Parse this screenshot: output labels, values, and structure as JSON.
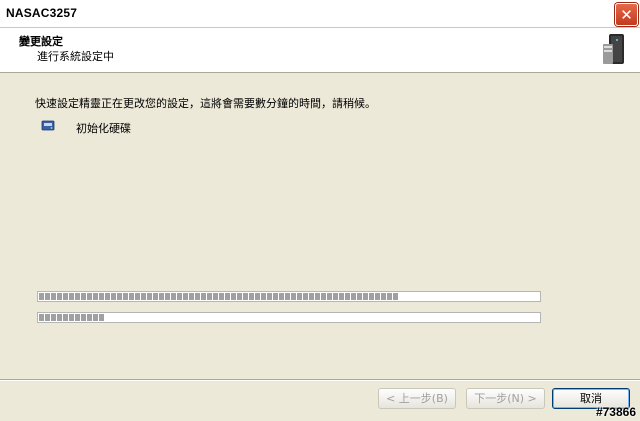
{
  "window": {
    "title": "NASAC3257",
    "close_symbol": "✕"
  },
  "header": {
    "title": "變更設定",
    "subtitle": "進行系統設定中",
    "icon": "nas-device-icon"
  },
  "main": {
    "message": "快速設定精靈正在更改您的設定，這將會需要數分鐘的時間，請稍候。",
    "task": {
      "icon": "hard-disk-icon",
      "label": "初始化硬碟"
    },
    "progress_overall": 0.72,
    "progress_current": 0.13
  },
  "footer": {
    "back_label": "< 上一步(B)",
    "next_label": "下一步(N) >",
    "cancel_label": "取消"
  },
  "watermark": "#73866"
}
